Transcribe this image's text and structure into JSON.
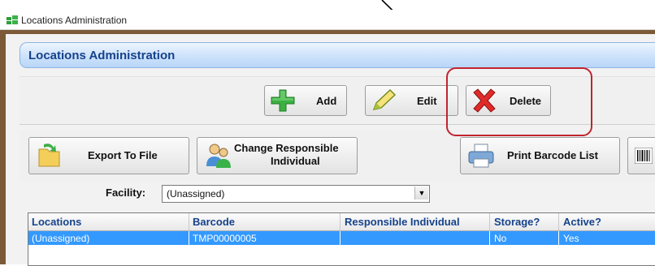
{
  "window": {
    "title": "Locations Administration"
  },
  "panel": {
    "title": "Locations Administration"
  },
  "toolbar": {
    "add_label": "Add",
    "edit_label": "Edit",
    "delete_label": "Delete"
  },
  "actions": {
    "export_label": "Export To File",
    "change_responsible_line1": "Change Responsible",
    "change_responsible_line2": "Individual",
    "print_barcode_label": "Print Barcode List"
  },
  "facility": {
    "label": "Facility:",
    "selected": "(Unassigned)"
  },
  "grid": {
    "columns": [
      "Locations",
      "Barcode",
      "Responsible Individual",
      "Storage?",
      "Active?"
    ],
    "rows": [
      {
        "location": "(Unassigned)",
        "barcode": "TMP00000005",
        "responsible": "",
        "storage": "No",
        "active": "Yes"
      }
    ]
  },
  "colors": {
    "highlight_row": "#3399ff",
    "panel_title": "#15428b",
    "callout_border": "#c0242e",
    "window_frame": "#7c5a38"
  },
  "icons": {
    "add": "green-plus-icon",
    "edit": "pencil-icon",
    "delete": "red-x-icon",
    "export": "folder-arrow-icon",
    "change_responsible": "people-icon",
    "print": "printer-icon",
    "barcode": "barcode-icon"
  }
}
